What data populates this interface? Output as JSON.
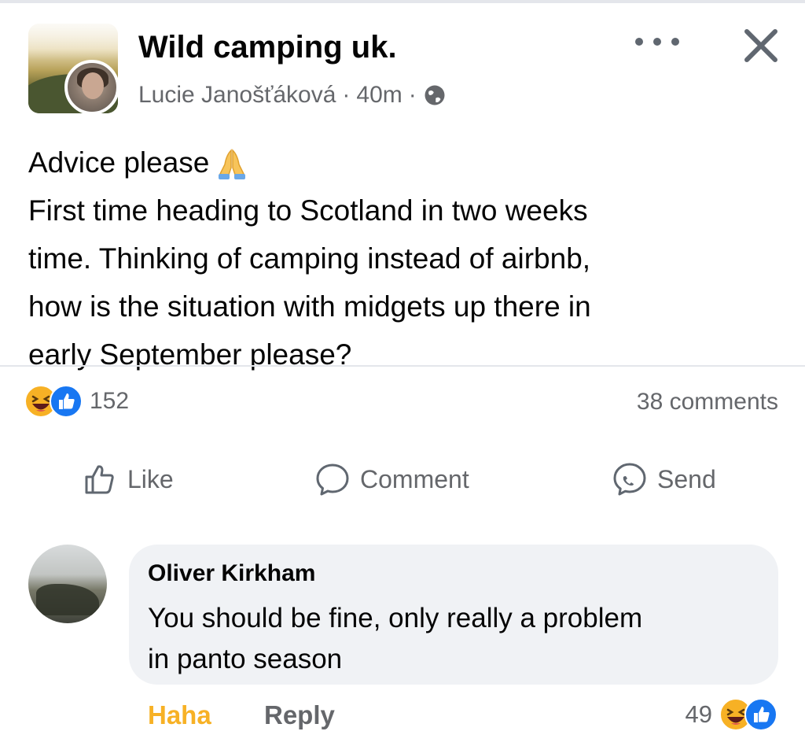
{
  "post": {
    "group_name": "Wild camping uk.",
    "author": "Lucie Janošťáková",
    "separator": "·",
    "time": "40m",
    "privacy_icon": "globe-icon",
    "lines": [
      "Advice please",
      "First time heading to Scotland in two weeks",
      "time. Thinking of camping instead of airbnb,",
      "how is the situation with midgets up there in",
      "early September please?"
    ],
    "emoji": "folded-hands-icon"
  },
  "header_actions": {
    "more_icon": "more-icon",
    "close_icon": "close-icon"
  },
  "stats": {
    "reaction_icons": [
      "haha-icon",
      "like-icon"
    ],
    "reaction_count": "152",
    "comments": "38 comments"
  },
  "actions": {
    "like": "Like",
    "comment": "Comment",
    "send": "Send"
  },
  "comment": {
    "author": "Oliver Kirkham",
    "lines": [
      "You should be fine, only really a problem",
      "in panto season"
    ],
    "haha": "Haha",
    "reply": "Reply",
    "reaction_count": "49",
    "reaction_icons": [
      "haha-icon",
      "like-icon"
    ]
  },
  "colors": {
    "text": "#050505",
    "secondary": "#65676b",
    "haha_yellow": "#f7b125",
    "like_blue": "#1877f2",
    "bubble": "#f0f2f5"
  }
}
